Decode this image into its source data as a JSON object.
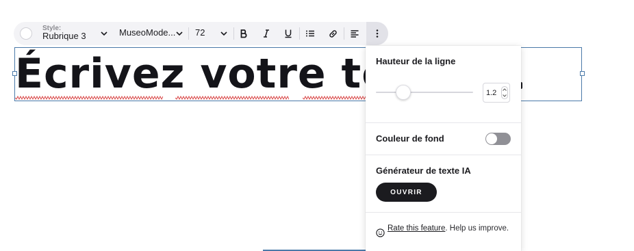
{
  "toolbar": {
    "style_label": "Style:",
    "style_value": "Rubrique 3",
    "font_value": "MuseoMode...",
    "size_value": "72",
    "buttons": {
      "bold": "bold-icon",
      "italic": "italic-icon",
      "underline": "underline-icon",
      "list": "bulleted-list-icon",
      "link": "link-icon",
      "align": "align-left-icon",
      "more": "more-vertical-icon"
    }
  },
  "canvas": {
    "headline": "Écrivez votre tex"
  },
  "panel": {
    "line_height": {
      "title": "Hauteur de la ligne",
      "value": "1.2",
      "slider_fraction": 0.28
    },
    "background_color": {
      "title": "Couleur de fond",
      "enabled": false
    },
    "ai_generator": {
      "title": "Générateur de texte IA",
      "button_label": "OUVRIR"
    },
    "feedback": {
      "link_text": "Rate this feature",
      "rest_text": ". Help us improve."
    }
  },
  "colors": {
    "accent_border": "#4a79a8",
    "dark": "#1b1b1f",
    "toolbar_bg": "#f3f3f6",
    "toggle_off": "#909096",
    "spellcheck": "#d94a4a"
  }
}
